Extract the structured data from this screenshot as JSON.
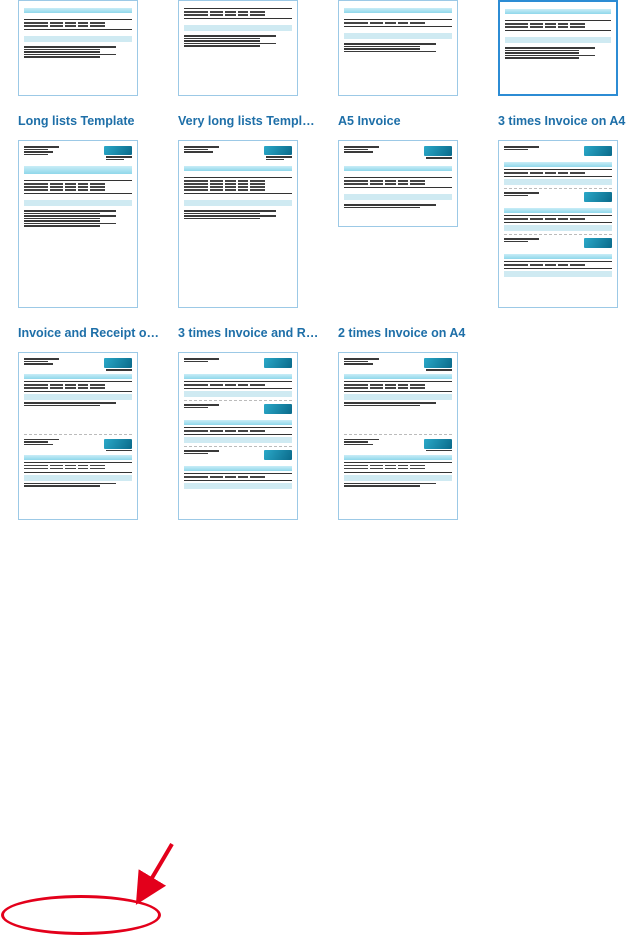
{
  "rows": [
    {
      "items": [
        {
          "label": "",
          "thumb": "top",
          "selected": false
        },
        {
          "label": "",
          "thumb": "top",
          "selected": false
        },
        {
          "label": "",
          "thumb": "top",
          "selected": false
        },
        {
          "label": "",
          "thumb": "top",
          "selected": true
        }
      ]
    },
    {
      "items": [
        {
          "label": "Long lists Template",
          "thumb": "tall",
          "content": "single",
          "selected": false
        },
        {
          "label": "Very long lists Templ…",
          "thumb": "tall",
          "content": "single",
          "selected": false
        },
        {
          "label": "A5 Invoice",
          "thumb": "short",
          "content": "a5",
          "selected": false
        },
        {
          "label": "3 times Invoice on A4",
          "thumb": "tall",
          "content": "triple",
          "selected": false
        }
      ]
    },
    {
      "items": [
        {
          "label": "Invoice and Receipt o…",
          "thumb": "tall",
          "content": "double",
          "selected": false
        },
        {
          "label": "3 times Invoice and R…",
          "thumb": "tall",
          "content": "triple",
          "selected": false
        },
        {
          "label": "2 times Invoice on A4",
          "thumb": "tall",
          "content": "double",
          "selected": false
        },
        {
          "label": "",
          "thumb": "none"
        }
      ]
    }
  ],
  "annotation": {
    "target_label": "Invoice and Receipt o…",
    "row": 2,
    "col": 0
  }
}
